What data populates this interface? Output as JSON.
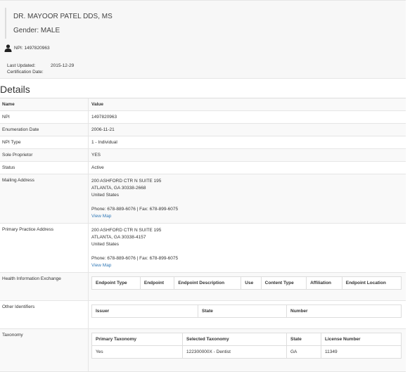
{
  "provider": {
    "name": "DR. MAYOOR PATEL DDS, MS",
    "gender": "Gender: MALE",
    "npi_label": "NPI: 1497820963",
    "last_updated_label": "Last Updated:",
    "last_updated_value": "2015-12-29",
    "certification_label": "Certification Date:"
  },
  "details": {
    "title": "Details",
    "headers": {
      "name": "Name",
      "value": "Value"
    },
    "npi": {
      "label": "NPI",
      "value": "1497820963"
    },
    "enumeration": {
      "label": "Enumeration Date",
      "value": "2006-11-21"
    },
    "npi_type": {
      "label": "NPI Type",
      "value": "1 - Individual"
    },
    "sole": {
      "label": "Sole Proprietor",
      "value": "YES"
    },
    "status": {
      "label": "Status",
      "value": "Active"
    },
    "mailing": {
      "label": "Mailing Address",
      "line1": "200 ASHFORD CTR N SUITE 195",
      "line2": "ATLANTA, GA 30338-2668",
      "line3": "United States",
      "phone": "Phone: 678-889-6076 | Fax: 678-899-6075",
      "map": "View Map"
    },
    "practice": {
      "label": "Primary Practice Address",
      "line1": "200 ASHFORD CTR N SUITE 195",
      "line2": "ATLANTA, GA 30338-4157",
      "line3": "United States",
      "phone": "Phone: 678-889-6076 | Fax: 678-899-6075",
      "map": "View Map"
    },
    "hie": {
      "label": "Health Information Exchange",
      "columns": [
        "Endpoint Type",
        "Endpoint",
        "Endpoint Description",
        "Use",
        "Content Type",
        "Affiliation",
        "Endpoint Location"
      ]
    },
    "other_ids": {
      "label": "Other Identifiers",
      "columns": [
        "Issuer",
        "State",
        "Number"
      ]
    },
    "taxonomy": {
      "label": "Taxonomy",
      "columns": [
        "Primary Taxonomy",
        "Selected Taxonomy",
        "State",
        "License Number"
      ],
      "rows": [
        [
          "Yes",
          "122300000X - Dentist",
          "GA",
          "11349"
        ]
      ]
    }
  }
}
